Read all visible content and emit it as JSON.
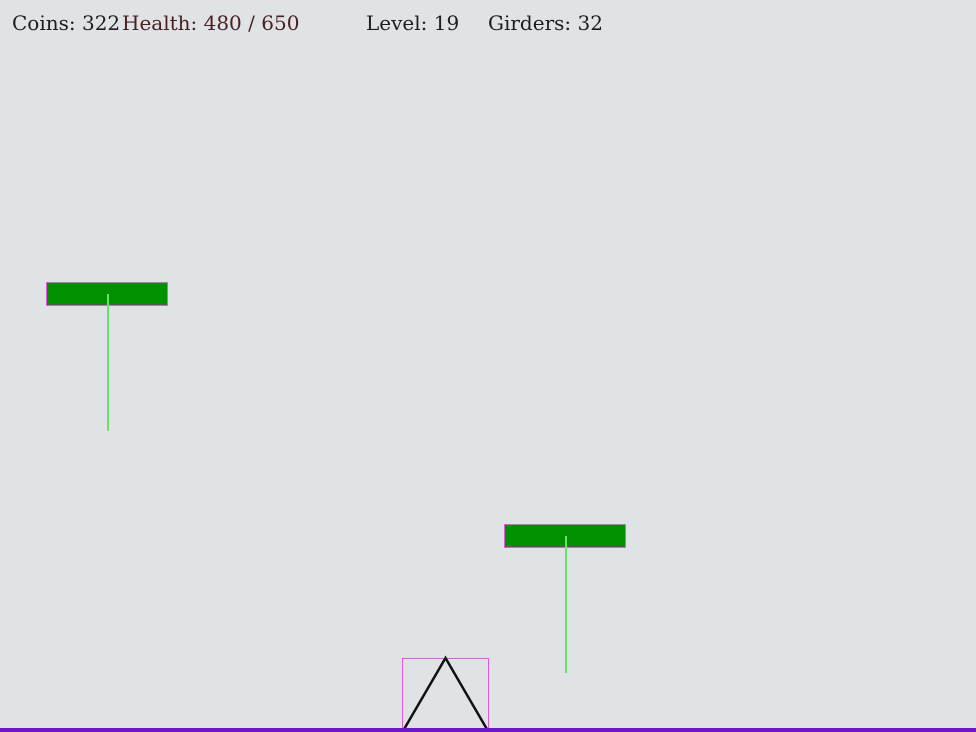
{
  "hud": {
    "coins": "Coins: 322",
    "health": "Health: 480 / 650",
    "level": "Level: 19",
    "girders": "Girders: 32"
  },
  "colors": {
    "background": "#dfe3e6",
    "girder_fill": "#009000",
    "girder_outline": "#e457e2",
    "tether": "#67e36a",
    "player_box": "#e457e2",
    "player_shape": "#111111",
    "ground": "#6a18c8",
    "health_text": "#4a1f1f"
  },
  "icons": {
    "player": "triangle-icon"
  }
}
